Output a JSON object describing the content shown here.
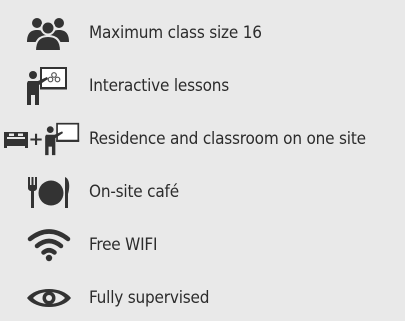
{
  "colors": {
    "background": "#e9e9e9",
    "icon": "#333333",
    "text": "#2c2c2c"
  },
  "features": [
    {
      "label": "Maximum class size 16",
      "icon": "group-icon"
    },
    {
      "label": "Interactive lessons",
      "icon": "teacher-presentation-icon"
    },
    {
      "label": "Residence and classroom on one site",
      "icon": "bed-plus-classroom-icon"
    },
    {
      "label": "On-site café",
      "icon": "plate-cutlery-icon"
    },
    {
      "label": "Free WIFI",
      "icon": "wifi-icon"
    },
    {
      "label": "Fully supervised",
      "icon": "eye-icon"
    }
  ],
  "plus_sign": "+"
}
